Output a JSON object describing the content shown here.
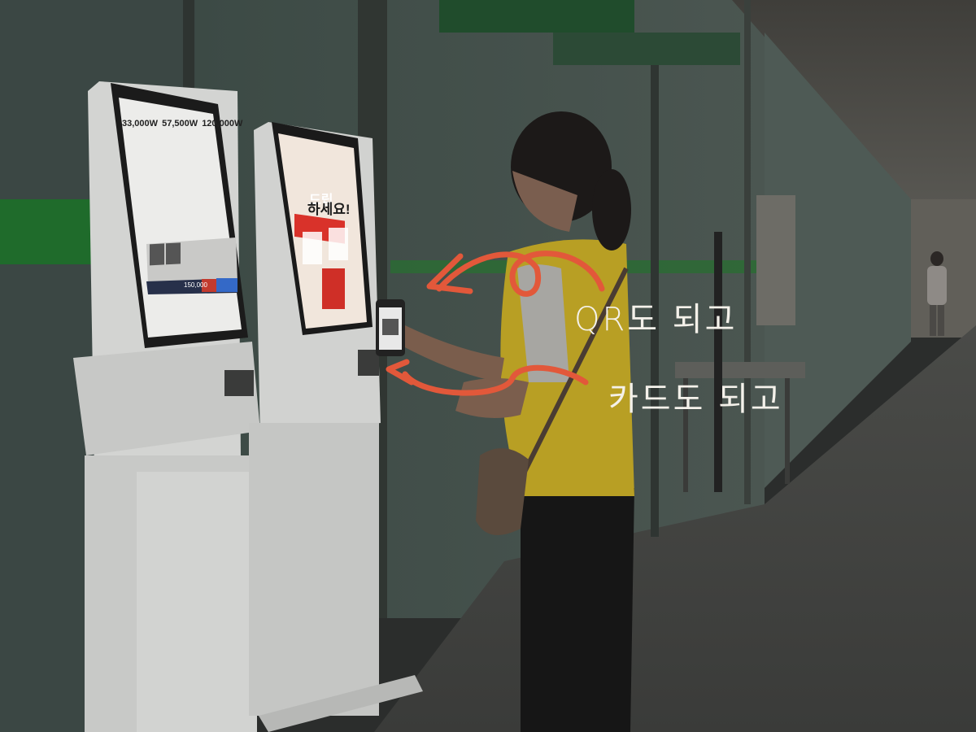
{
  "captions": {
    "qr": "QR도 되고",
    "card": "카드도 되고"
  },
  "kiosk_left": {
    "prices": [
      "33,000W",
      "57,500W",
      "120,000W"
    ],
    "total": "150,000"
  },
  "kiosk_right": {
    "line1": "드립",
    "line2": "하세요!"
  },
  "colors": {
    "arrow": "#e2583a",
    "caption": "#f4f1ea",
    "wall_green": "#1f6b2b"
  }
}
